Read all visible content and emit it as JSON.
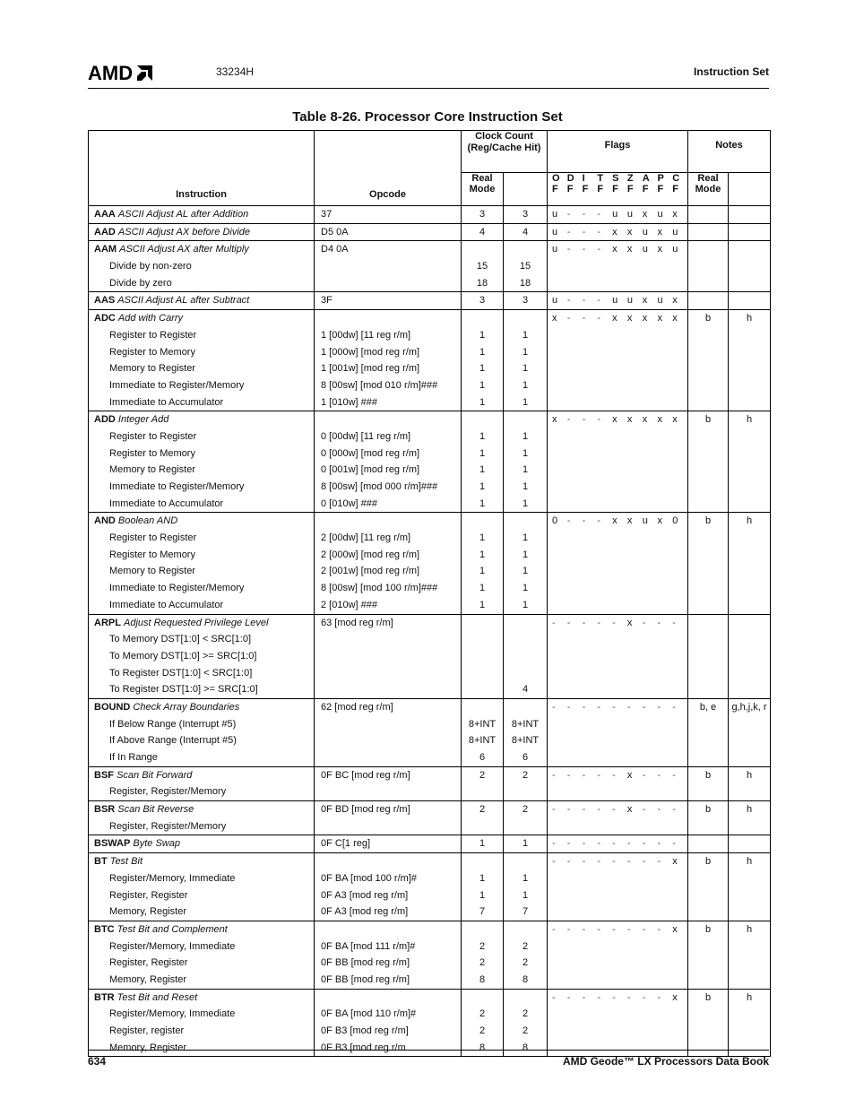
{
  "header": {
    "logo": "AMD",
    "doc_number": "33234H",
    "section": "Instruction Set"
  },
  "title": "Table 8-26.  Processor Core Instruction Set",
  "columns": {
    "instruction": "Instruction",
    "opcode": "Opcode",
    "clock_count": "Clock Count (Reg/Cache Hit)",
    "clock_real_mode": "Real Mode",
    "flags": "Flags",
    "flag_names": [
      [
        "O",
        "F"
      ],
      [
        "D",
        "F"
      ],
      [
        "I",
        "F"
      ],
      [
        "T",
        "F"
      ],
      [
        "S",
        "F"
      ],
      [
        "Z",
        "F"
      ],
      [
        "A",
        "F"
      ],
      [
        "P",
        "F"
      ],
      [
        "C",
        "F"
      ]
    ],
    "notes": "Notes",
    "notes_real_mode": "Real Mode"
  },
  "groups": [
    {
      "mnemonic": "AAA",
      "desc": "ASCII Adjust AL after Addition",
      "opcode": "37",
      "real": "3",
      "clock2": "3",
      "flags": [
        "u",
        "-",
        "-",
        "-",
        "u",
        "u",
        "x",
        "u",
        "x"
      ],
      "note1": "",
      "note2": "",
      "rows": []
    },
    {
      "mnemonic": "AAD",
      "desc": "ASCII Adjust AX before Divide",
      "opcode": "D5 0A",
      "real": "4",
      "clock2": "4",
      "flags": [
        "u",
        "-",
        "-",
        "-",
        "x",
        "x",
        "u",
        "x",
        "u"
      ],
      "note1": "",
      "note2": "",
      "rows": []
    },
    {
      "mnemonic": "AAM",
      "desc": "ASCII Adjust AX after Multiply",
      "opcode": "D4 0A",
      "real": "",
      "clock2": "",
      "flags": [
        "u",
        "-",
        "-",
        "-",
        "x",
        "x",
        "u",
        "x",
        "u"
      ],
      "note1": "",
      "note2": "",
      "rows": [
        {
          "label": "Divide by non-zero",
          "opcode": "",
          "real": "15",
          "clock2": "15"
        },
        {
          "label": "Divide by zero",
          "opcode": "",
          "real": "18",
          "clock2": "18"
        }
      ]
    },
    {
      "mnemonic": "AAS",
      "desc": "ASCII Adjust AL after Subtract",
      "opcode": "3F",
      "real": "3",
      "clock2": "3",
      "flags": [
        "u",
        "-",
        "-",
        "-",
        "u",
        "u",
        "x",
        "u",
        "x"
      ],
      "note1": "",
      "note2": "",
      "rows": []
    },
    {
      "mnemonic": "ADC",
      "desc": "Add with Carry",
      "opcode": "",
      "real": "",
      "clock2": "",
      "flags": [
        "x",
        "-",
        "-",
        "-",
        "x",
        "x",
        "x",
        "x",
        "x"
      ],
      "note1": "b",
      "note2": "h",
      "rows": [
        {
          "label": "Register to Register",
          "opcode": "1 [00dw] [11 reg r/m]",
          "real": "1",
          "clock2": "1"
        },
        {
          "label": "Register to Memory",
          "opcode": "1 [000w] [mod reg r/m]",
          "real": "1",
          "clock2": "1"
        },
        {
          "label": "Memory to Register",
          "opcode": "1 [001w] [mod reg r/m]",
          "real": "1",
          "clock2": "1"
        },
        {
          "label": "Immediate to Register/Memory",
          "opcode": "8 [00sw] [mod 010 r/m]###",
          "real": "1",
          "clock2": "1"
        },
        {
          "label": "Immediate to Accumulator",
          "opcode": "1 [010w] ###",
          "real": "1",
          "clock2": "1"
        }
      ]
    },
    {
      "mnemonic": "ADD",
      "desc": "Integer Add",
      "opcode": "",
      "real": "",
      "clock2": "",
      "flags": [
        "x",
        "-",
        "-",
        "-",
        "x",
        "x",
        "x",
        "x",
        "x"
      ],
      "note1": "b",
      "note2": "h",
      "rows": [
        {
          "label": "Register to Register",
          "opcode": "0 [00dw] [11 reg r/m]",
          "real": "1",
          "clock2": "1"
        },
        {
          "label": "Register to Memory",
          "opcode": "0 [000w] [mod reg r/m]",
          "real": "1",
          "clock2": "1"
        },
        {
          "label": "Memory to Register",
          "opcode": "0 [001w] [mod reg r/m]",
          "real": "1",
          "clock2": "1"
        },
        {
          "label": "Immediate to Register/Memory",
          "opcode": "8 [00sw] [mod 000 r/m]###",
          "real": "1",
          "clock2": "1"
        },
        {
          "label": "Immediate to Accumulator",
          "opcode": "0 [010w] ###",
          "real": "1",
          "clock2": "1"
        }
      ]
    },
    {
      "mnemonic": "AND",
      "desc": "Boolean AND",
      "opcode": "",
      "real": "",
      "clock2": "",
      "flags": [
        "0",
        "-",
        "-",
        "-",
        "x",
        "x",
        "u",
        "x",
        "0"
      ],
      "note1": "b",
      "note2": "h",
      "rows": [
        {
          "label": "Register to Register",
          "opcode": "2 [00dw] [11 reg r/m]",
          "real": "1",
          "clock2": "1"
        },
        {
          "label": "Register to Memory",
          "opcode": "2 [000w] [mod reg r/m]",
          "real": "1",
          "clock2": "1"
        },
        {
          "label": "Memory to Register",
          "opcode": "2 [001w] [mod reg r/m]",
          "real": "1",
          "clock2": "1"
        },
        {
          "label": "Immediate to Register/Memory",
          "opcode": "8 [00sw] [mod 100 r/m]###",
          "real": "1",
          "clock2": "1"
        },
        {
          "label": "Immediate to Accumulator",
          "opcode": "2 [010w] ###",
          "real": "1",
          "clock2": "1"
        }
      ]
    },
    {
      "mnemonic": "ARPL",
      "desc": "Adjust Requested Privilege Level",
      "opcode": "63 [mod reg r/m]",
      "real": "",
      "clock2": "",
      "flags": [
        "-",
        "-",
        "-",
        "-",
        "-",
        "x",
        "-",
        "-",
        "-"
      ],
      "note1": "",
      "note2": "",
      "rows": [
        {
          "label": "To Memory DST[1:0] < SRC[1:0]",
          "opcode": "",
          "real": "",
          "clock2": ""
        },
        {
          "label": "To Memory DST[1:0] >= SRC[1:0]",
          "opcode": "",
          "real": "",
          "clock2": ""
        },
        {
          "label": "To Register DST[1:0] < SRC[1:0]",
          "opcode": "",
          "real": "",
          "clock2": ""
        },
        {
          "label": "To Register DST[1:0] >= SRC[1:0]",
          "opcode": "",
          "real": "",
          "clock2": "4"
        }
      ]
    },
    {
      "mnemonic": "BOUND",
      "desc": "Check Array Boundaries",
      "opcode": "62 [mod reg r/m]",
      "real": "",
      "clock2": "",
      "flags": [
        "-",
        "-",
        "-",
        "-",
        "-",
        "-",
        "-",
        "-",
        "-"
      ],
      "note1": "b, e",
      "note2": "g,h,j,k, r",
      "rows": [
        {
          "label": "If Below Range (Interrupt #5)",
          "opcode": "",
          "real": "8+INT",
          "clock2": "8+INT"
        },
        {
          "label": "If Above Range (Interrupt #5)",
          "opcode": "",
          "real": "8+INT",
          "clock2": "8+INT"
        },
        {
          "label": "If In Range",
          "opcode": "",
          "real": "6",
          "clock2": "6"
        }
      ]
    },
    {
      "mnemonic": "BSF",
      "desc": "Scan Bit Forward",
      "opcode": "0F BC [mod reg r/m]",
      "real": "2",
      "clock2": "2",
      "flags": [
        "-",
        "-",
        "-",
        "-",
        "-",
        "x",
        "-",
        "-",
        "-"
      ],
      "note1": "b",
      "note2": "h",
      "rows": [
        {
          "label": "Register, Register/Memory",
          "opcode": "",
          "real": "",
          "clock2": ""
        }
      ]
    },
    {
      "mnemonic": "BSR",
      "desc": "Scan Bit Reverse",
      "opcode": "0F BD [mod reg r/m]",
      "real": "2",
      "clock2": "2",
      "flags": [
        "-",
        "-",
        "-",
        "-",
        "-",
        "x",
        "-",
        "-",
        "-"
      ],
      "note1": "b",
      "note2": "h",
      "rows": [
        {
          "label": "Register, Register/Memory",
          "opcode": "",
          "real": "",
          "clock2": ""
        }
      ]
    },
    {
      "mnemonic": "BSWAP",
      "desc": "Byte Swap",
      "opcode": "0F C[1 reg]",
      "real": "1",
      "clock2": "1",
      "flags": [
        "-",
        "-",
        "-",
        "-",
        "-",
        "-",
        "-",
        "-",
        "-"
      ],
      "note1": "",
      "note2": "",
      "rows": []
    },
    {
      "mnemonic": "BT",
      "desc": "Test Bit",
      "opcode": "",
      "real": "",
      "clock2": "",
      "flags": [
        "-",
        "-",
        "-",
        "-",
        "-",
        "-",
        "-",
        "-",
        "x"
      ],
      "note1": "b",
      "note2": "h",
      "rows": [
        {
          "label": "Register/Memory, Immediate",
          "opcode": "0F BA [mod 100 r/m]#",
          "real": "1",
          "clock2": "1"
        },
        {
          "label": "Register, Register",
          "opcode": "0F A3 [mod reg r/m]",
          "real": "1",
          "clock2": "1"
        },
        {
          "label": "Memory, Register",
          "opcode": "0F A3 [mod reg r/m]",
          "real": "7",
          "clock2": "7"
        }
      ]
    },
    {
      "mnemonic": "BTC",
      "desc": "Test Bit and Complement",
      "opcode": "",
      "real": "",
      "clock2": "",
      "flags": [
        "-",
        "-",
        "-",
        "-",
        "-",
        "-",
        "-",
        "-",
        "x"
      ],
      "note1": "b",
      "note2": "h",
      "rows": [
        {
          "label": "Register/Memory, Immediate",
          "opcode": "0F BA [mod 111 r/m]#",
          "real": "2",
          "clock2": "2"
        },
        {
          "label": "Register, Register",
          "opcode": "0F BB [mod reg r/m]",
          "real": "2",
          "clock2": "2"
        },
        {
          "label": "Memory, Register",
          "opcode": "0F BB [mod reg r/m]",
          "real": "8",
          "clock2": "8"
        }
      ]
    },
    {
      "mnemonic": "BTR",
      "desc": "Test Bit and Reset",
      "opcode": "",
      "real": "",
      "clock2": "",
      "flags": [
        "-",
        "-",
        "-",
        "-",
        "-",
        "-",
        "-",
        "-",
        "x"
      ],
      "note1": "b",
      "note2": "h",
      "rows": [
        {
          "label": "Register/Memory, Immediate",
          "opcode": "0F BA [mod 110 r/m]#",
          "real": "2",
          "clock2": "2"
        },
        {
          "label": "Register, register",
          "opcode": "0F B3 [mod reg r/m]",
          "real": "2",
          "clock2": "2"
        },
        {
          "label": "Memory, Register",
          "opcode": "0F B3 [mod reg r/m",
          "real": "8",
          "clock2": "8"
        }
      ]
    }
  ],
  "footer": {
    "page_number": "634",
    "book_title": "AMD Geode™ LX Processors Data Book"
  }
}
